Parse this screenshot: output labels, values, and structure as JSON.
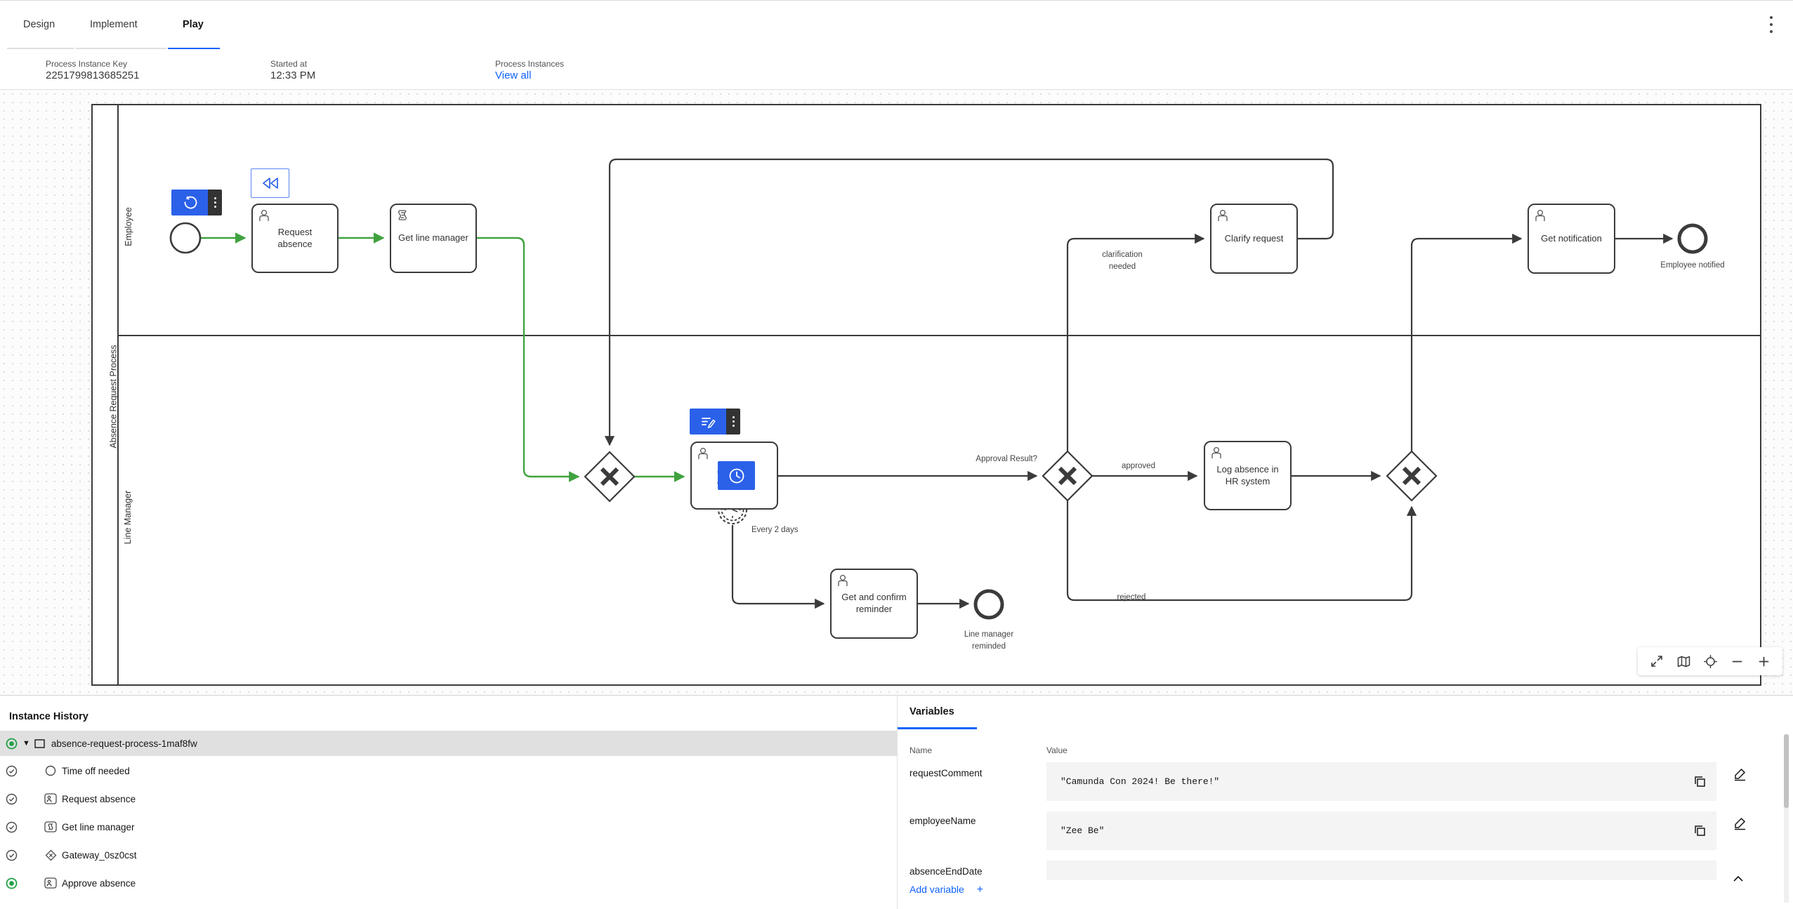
{
  "tabs": {
    "design": "Design",
    "implement": "Implement",
    "play": "Play"
  },
  "info": {
    "key_label": "Process Instance Key",
    "key_value": "2251799813685251",
    "started_label": "Started at",
    "started_value": "12:33 PM",
    "instances_label": "Process Instances",
    "view_all": "View all"
  },
  "diagram": {
    "pool_label": "Absence Request Process",
    "lanes": {
      "top": "Employee",
      "bottom": "Line Manager"
    },
    "tasks": {
      "request_absence": "Request absence",
      "get_line_manager": "Get line manager",
      "clarify_request": "Clarify request",
      "get_notification": "Get notification",
      "approve_absence": "Approve absence",
      "log_absence": "Log absence in HR system",
      "get_confirm_reminder": "Get and confirm reminder"
    },
    "flow_labels": {
      "clarification_needed": "clarification needed",
      "approval_result": "Approval Result?",
      "approved": "approved",
      "rejected": "rejected",
      "every_2_days": "Every 2 days"
    },
    "event_labels": {
      "employee_notified": "Employee notified",
      "line_manager_reminded": "Line manager reminded"
    }
  },
  "history": {
    "title": "Instance History",
    "root_label": "absence-request-process-1maf8fw",
    "items": [
      {
        "label": "Time off needed",
        "icon": "start-event",
        "status": "completed"
      },
      {
        "label": "Request absence",
        "icon": "user-task",
        "status": "completed"
      },
      {
        "label": "Get line manager",
        "icon": "script-task",
        "status": "completed"
      },
      {
        "label": "Gateway_0sz0cst",
        "icon": "gateway",
        "status": "completed"
      },
      {
        "label": "Approve absence",
        "icon": "user-task",
        "status": "active"
      }
    ]
  },
  "variables": {
    "tab_label": "Variables",
    "name_col": "Name",
    "value_col": "Value",
    "rows": [
      {
        "name": "requestComment",
        "value": "\"Camunda Con 2024! Be there!\""
      },
      {
        "name": "employeeName",
        "value": "\"Zee Be\""
      },
      {
        "name": "absenceEndDate",
        "value": ""
      }
    ],
    "add_label": "Add variable",
    "add_plus": "+"
  },
  "colors": {
    "accent_blue": "#0f62fe",
    "overlay_blue": "#2b61e9",
    "flow_green": "#3fa23f",
    "status_green": "#24a148",
    "shape_stroke": "#3b3b3b"
  }
}
